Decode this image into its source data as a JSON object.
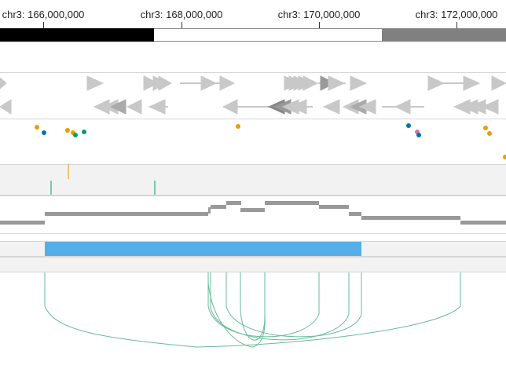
{
  "ruler": {
    "ticks": [
      {
        "label": "chr3: 166,000,000"
      },
      {
        "label": "chr3: 168,000,000"
      },
      {
        "label": "chr3: 170,000,000"
      },
      {
        "label": "chr3: 172,000,000"
      }
    ]
  },
  "colors": {
    "ideogram_dark": "#000000",
    "ideogram_light": "#ffffff",
    "ideogram_mid": "#808080",
    "gene_glyph": "#c8c8c8",
    "dot_orange": "#e69f00",
    "dot_blue": "#0072b2",
    "dot_green": "#009e73",
    "dot_pink": "#cc79a7",
    "bar_blue": "#56aee6",
    "step_gray": "#999999",
    "arc_green": "#66bb99"
  },
  "tracks": [
    {
      "name": "ideogram"
    },
    {
      "name": "gene-annotations"
    },
    {
      "name": "point-track"
    },
    {
      "name": "bar-track"
    },
    {
      "name": "line-track"
    },
    {
      "name": "interval-track"
    },
    {
      "name": "arc-track"
    }
  ]
}
